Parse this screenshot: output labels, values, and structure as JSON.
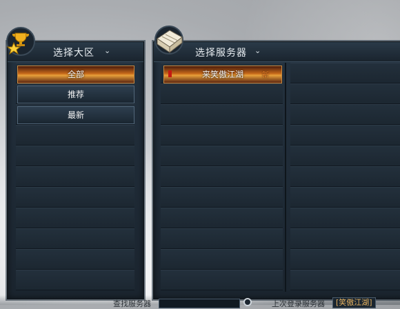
{
  "left_panel": {
    "title": "选择大区",
    "chevron": "⌄",
    "emblem_icon": "trophy-star-icon",
    "buttons": [
      {
        "label": "全部",
        "active": true
      },
      {
        "label": "推荐",
        "active": false
      },
      {
        "label": "最新",
        "active": false
      }
    ]
  },
  "right_panel": {
    "title": "选择服务器",
    "chevron": "⌄",
    "emblem_icon": "scroll-map-icon",
    "servers": [
      {
        "name": "来笑傲江湖",
        "badge": "新",
        "status_color": "#c41a12"
      }
    ]
  },
  "bottom": {
    "search_label": "查找服务器",
    "search_value": "",
    "search_icon": "search-icon",
    "last_label": "上次登录服务器",
    "last_value": "[笑傲江湖]"
  },
  "colors": {
    "panel_bg": "#1f2a35",
    "active_btn": "#d0782a",
    "badge": "#ff8a2a"
  }
}
